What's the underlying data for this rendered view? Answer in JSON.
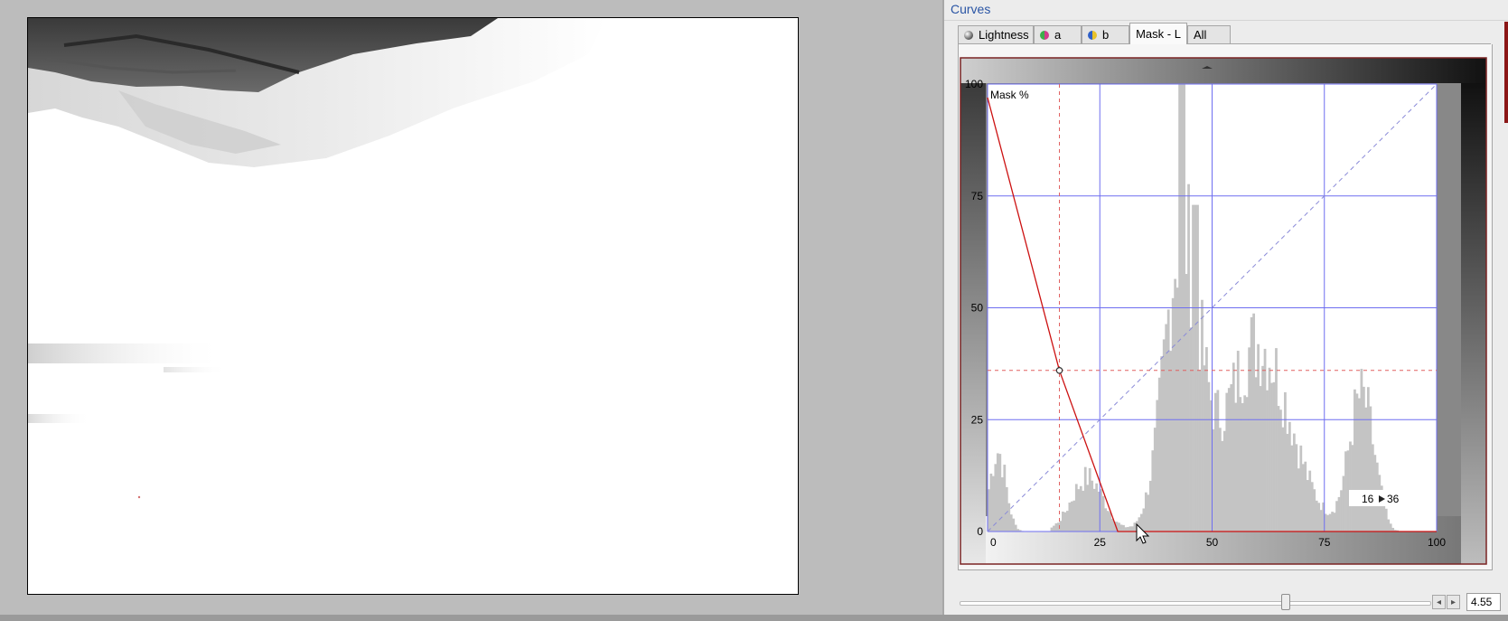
{
  "panel": {
    "title": "Curves"
  },
  "tabs": [
    {
      "label": "Lightness",
      "icon": "lightness-channel-icon",
      "active": false
    },
    {
      "label": "a",
      "icon": "a-channel-icon",
      "active": false
    },
    {
      "label": "b",
      "icon": "b-channel-icon",
      "active": false
    },
    {
      "label": "Mask - L",
      "active": true
    },
    {
      "label": "All",
      "active": false
    }
  ],
  "graph": {
    "curve_label": "Mask %",
    "y_ticks": [
      "100",
      "75",
      "50",
      "25",
      "0"
    ],
    "x_ticks": [
      "0",
      "25",
      "50",
      "75",
      "100"
    ],
    "readout_input": "16",
    "readout_output": "36",
    "control_point": {
      "input": 16,
      "output": 36
    },
    "curve_points": [
      [
        0,
        97
      ],
      [
        16,
        36
      ],
      [
        29,
        0
      ],
      [
        100,
        0
      ]
    ],
    "histogram_peak_positions": [
      43,
      46,
      83
    ],
    "colors": {
      "curve": "#cc1111",
      "grid": "#6e6ef0",
      "diagonal": "#8a8ad8",
      "crosshair": "#e06060",
      "histogram": "#c4c4c4"
    }
  },
  "slider": {
    "value": "4.55"
  }
}
